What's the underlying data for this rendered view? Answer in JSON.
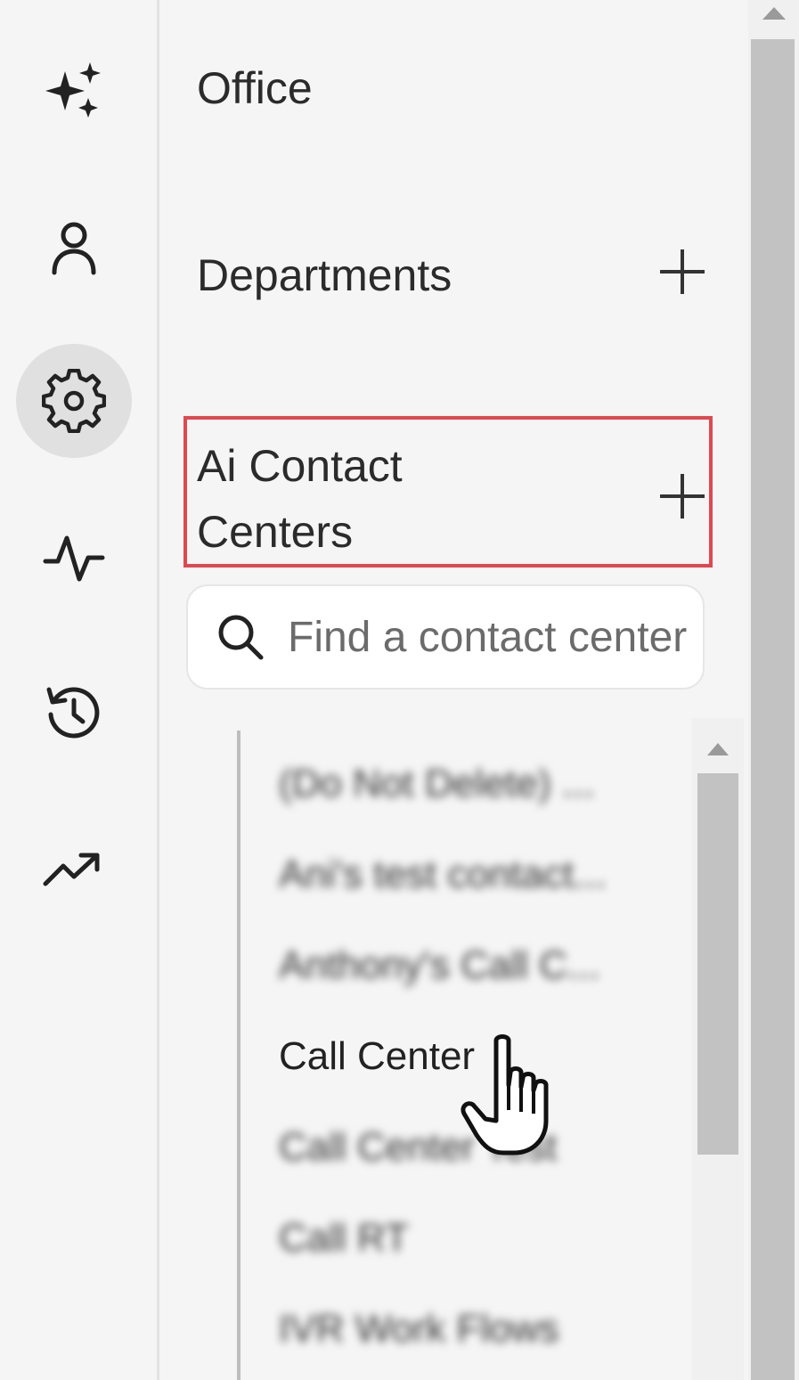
{
  "rail": {
    "items": [
      {
        "icon": "sparkles-icon",
        "active": false
      },
      {
        "icon": "user-icon",
        "active": false
      },
      {
        "icon": "gear-icon",
        "active": true
      },
      {
        "icon": "activity-icon",
        "active": false
      },
      {
        "icon": "history-icon",
        "active": false
      },
      {
        "icon": "trending-up-icon",
        "active": false
      }
    ]
  },
  "panel": {
    "office_label": "Office",
    "departments_label": "Departments",
    "contact_centers_line1": "Ai Contact",
    "contact_centers_line2": "Centers"
  },
  "search": {
    "placeholder": "Find a contact center"
  },
  "contact_centers": [
    {
      "label": "(Do Not Delete) ...",
      "blurred": true
    },
    {
      "label": "Ani's test contact...",
      "blurred": true
    },
    {
      "label": "Anthony's Call C...",
      "blurred": true
    },
    {
      "label": "Call Center",
      "blurred": false
    },
    {
      "label": "Call Center Test",
      "blurred": true
    },
    {
      "label": "Call RT",
      "blurred": true
    },
    {
      "label": "IVR Work Flows",
      "blurred": true
    }
  ],
  "colors": {
    "highlight": "#e0484f",
    "active_rail": "#e0e0e0"
  }
}
